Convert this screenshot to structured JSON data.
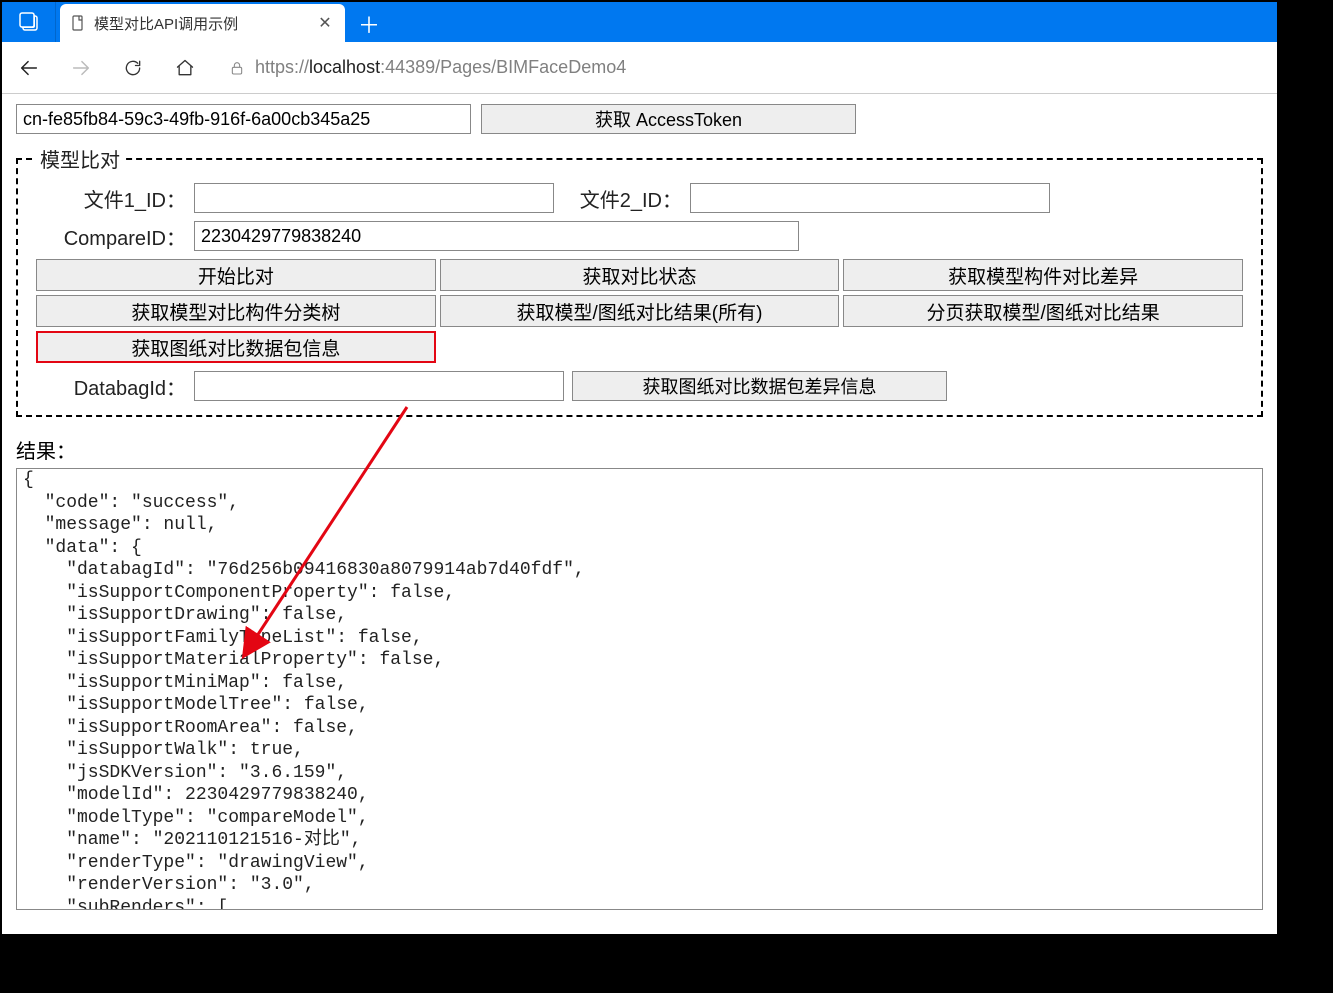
{
  "browser": {
    "tab_title": "模型对比API调用示例",
    "url_scheme_host_pre": "https://",
    "url_host": "localhost",
    "url_port_path": ":44389/Pages/BIMFaceDemo4"
  },
  "top": {
    "token_value": "cn-fe85fb84-59c3-49fb-916f-6a00cb345a25",
    "get_token_label": "获取 AccessToken"
  },
  "fieldset": {
    "legend": "模型比对",
    "file1_label": "文件1_ID：",
    "file1_value": "",
    "file2_label": "文件2_ID：",
    "file2_value": "",
    "compareid_label": "CompareID：",
    "compareid_value": "2230429779838240",
    "buttons": {
      "start_compare": "开始比对",
      "get_compare_status": "获取对比状态",
      "get_model_component_diff": "获取模型构件对比差异",
      "get_model_compare_component_tree": "获取模型对比构件分类树",
      "get_model_drawing_compare_all": "获取模型/图纸对比结果(所有)",
      "paged_get_model_drawing_compare": "分页获取模型/图纸对比结果",
      "get_drawing_compare_databag_info": "获取图纸对比数据包信息"
    },
    "databag_label": "DatabagId：",
    "databag_value": "",
    "get_drawing_compare_databag_diff": "获取图纸对比数据包差异信息"
  },
  "result_label": "结果：",
  "result_text": "{\n  \"code\": \"success\",\n  \"message\": null,\n  \"data\": {\n    \"databagId\": \"76d256b09416830a8079914ab7d40fdf\",\n    \"isSupportComponentProperty\": false,\n    \"isSupportDrawing\": false,\n    \"isSupportFamilyTypeList\": false,\n    \"isSupportMaterialProperty\": false,\n    \"isSupportMiniMap\": false,\n    \"isSupportModelTree\": false,\n    \"isSupportRoomArea\": false,\n    \"isSupportWalk\": true,\n    \"jsSDKVersion\": \"3.6.159\",\n    \"modelId\": 2230429779838240,\n    \"modelType\": \"compareModel\",\n    \"name\": \"202110121516-对比\",\n    \"renderType\": \"drawingView\",\n    \"renderVersion\": \"3.0\",\n    \"subRenders\": [\n"
}
